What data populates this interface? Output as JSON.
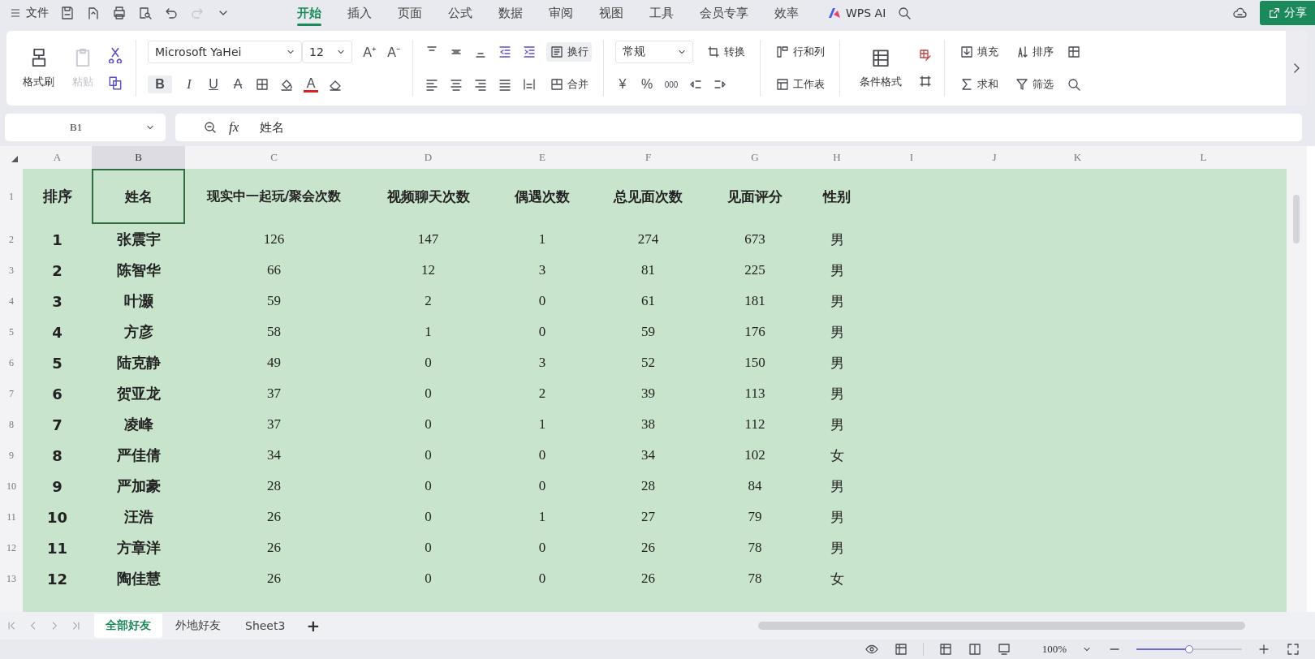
{
  "menu_bar": {
    "file": "文件",
    "tabs": [
      {
        "label": "开始",
        "selected": true
      },
      {
        "label": "插入",
        "selected": false
      },
      {
        "label": "页面",
        "selected": false
      },
      {
        "label": "公式",
        "selected": false
      },
      {
        "label": "数据",
        "selected": false
      },
      {
        "label": "审阅",
        "selected": false
      },
      {
        "label": "视图",
        "selected": false
      },
      {
        "label": "工具",
        "selected": false
      },
      {
        "label": "会员专享",
        "selected": false
      },
      {
        "label": "效率",
        "selected": false
      }
    ],
    "ai": "WPS AI",
    "share": "分享"
  },
  "ribbon": {
    "format_painter": "格式刷",
    "paste": {
      "label": "粘贴",
      "disabled": true
    },
    "font_family": "Microsoft YaHei",
    "font_size": "12",
    "grow_font": "A⁺",
    "shrink_font": "A⁻",
    "bold": "B",
    "italic": "I",
    "underline": "U",
    "strikethrough": "A",
    "font_color": "A",
    "wrap": "换行",
    "merge": "合并",
    "number_format": "常规",
    "convert": "转换",
    "currency": "¥",
    "percent": "%",
    "thousands": "000",
    "rows_cols": "行和列",
    "worksheet": "工作表",
    "conditional_format": "条件格式",
    "fill": "填充",
    "sort": "排序",
    "sum": "求和",
    "filter": "筛选"
  },
  "formula_bar": {
    "name_box": "B1",
    "function_label": "fx",
    "formula": "姓名"
  },
  "column_headers": [
    {
      "label": "A",
      "selected": false
    },
    {
      "label": "B",
      "selected": true
    },
    {
      "label": "C",
      "selected": false
    },
    {
      "label": "D",
      "selected": false
    },
    {
      "label": "E",
      "selected": false
    },
    {
      "label": "F",
      "selected": false
    },
    {
      "label": "G",
      "selected": false
    },
    {
      "label": "H",
      "selected": false
    },
    {
      "label": "I",
      "selected": false
    },
    {
      "label": "J",
      "selected": false
    },
    {
      "label": "K",
      "selected": false
    },
    {
      "label": "L",
      "selected": false
    }
  ],
  "header_row": {
    "number": "1",
    "cells": [
      {
        "text": "排序",
        "selected": false
      },
      {
        "text": "姓名",
        "selected": true
      },
      {
        "text": "现实中一起玩/聚会次数",
        "selected": false
      },
      {
        "text": "视频聊天次数",
        "selected": false
      },
      {
        "text": "偶遇次数",
        "selected": false
      },
      {
        "text": "总见面次数",
        "selected": false
      },
      {
        "text": "见面评分",
        "selected": false
      },
      {
        "text": "性别",
        "selected": false
      }
    ]
  },
  "rows": [
    {
      "number": "2",
      "cells": [
        "1",
        "张震宇",
        "126",
        "147",
        "1",
        "274",
        "673",
        "男"
      ]
    },
    {
      "number": "3",
      "cells": [
        "2",
        "陈智华",
        "66",
        "12",
        "3",
        "81",
        "225",
        "男"
      ]
    },
    {
      "number": "4",
      "cells": [
        "3",
        "叶灏",
        "59",
        "2",
        "0",
        "61",
        "181",
        "男"
      ]
    },
    {
      "number": "5",
      "cells": [
        "4",
        "方彦",
        "58",
        "1",
        "0",
        "59",
        "176",
        "男"
      ]
    },
    {
      "number": "6",
      "cells": [
        "5",
        "陆克静",
        "49",
        "0",
        "3",
        "52",
        "150",
        "男"
      ]
    },
    {
      "number": "7",
      "cells": [
        "6",
        "贺亚龙",
        "37",
        "0",
        "2",
        "39",
        "113",
        "男"
      ]
    },
    {
      "number": "8",
      "cells": [
        "7",
        "凌峰",
        "37",
        "0",
        "1",
        "38",
        "112",
        "男"
      ]
    },
    {
      "number": "9",
      "cells": [
        "8",
        "严佳倩",
        "34",
        "0",
        "0",
        "34",
        "102",
        "女"
      ]
    },
    {
      "number": "10",
      "cells": [
        "9",
        "严加豪",
        "28",
        "0",
        "0",
        "28",
        "84",
        "男"
      ]
    },
    {
      "number": "11",
      "cells": [
        "10",
        "汪浩",
        "26",
        "0",
        "1",
        "27",
        "79",
        "男"
      ]
    },
    {
      "number": "12",
      "cells": [
        "11",
        "方章洋",
        "26",
        "0",
        "0",
        "26",
        "78",
        "男"
      ]
    },
    {
      "number": "13",
      "cells": [
        "12",
        "陶佳慧",
        "26",
        "0",
        "0",
        "26",
        "78",
        "女"
      ]
    }
  ],
  "sheet_tabs": [
    {
      "label": "全部好友",
      "selected": true
    },
    {
      "label": "外地好友",
      "selected": false
    },
    {
      "label": "Sheet3",
      "selected": false
    }
  ],
  "add_sheet": "+",
  "status_bar": {
    "zoom": "100%",
    "zoom_slider": {
      "level": 0.5
    }
  }
}
